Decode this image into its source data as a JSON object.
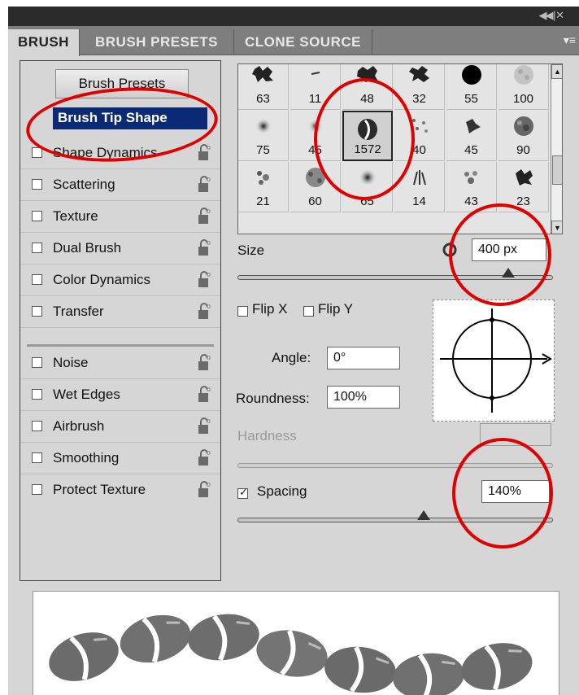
{
  "tabs": [
    {
      "label": "BRUSH",
      "active": true
    },
    {
      "label": "BRUSH PRESETS",
      "active": false
    },
    {
      "label": "CLONE SOURCE",
      "active": false
    }
  ],
  "sidebar": {
    "presets_button": "Brush Presets",
    "tip_shape": "Brush Tip Shape",
    "options": [
      {
        "label": "Shape Dynamics",
        "checked": false
      },
      {
        "label": "Scattering",
        "checked": false
      },
      {
        "label": "Texture",
        "checked": false
      },
      {
        "label": "Dual Brush",
        "checked": false
      },
      {
        "label": "Color Dynamics",
        "checked": false
      },
      {
        "label": "Transfer",
        "checked": false
      },
      {
        "label": "Noise",
        "checked": false
      },
      {
        "label": "Wet Edges",
        "checked": false
      },
      {
        "label": "Airbrush",
        "checked": false
      },
      {
        "label": "Smoothing",
        "checked": false
      },
      {
        "label": "Protect Texture",
        "checked": false
      }
    ]
  },
  "brush_grid": {
    "rows": [
      [
        "63",
        "11",
        "48",
        "32",
        "55",
        "100"
      ],
      [
        "75",
        "45",
        "1572",
        "40",
        "45",
        "90"
      ],
      [
        "21",
        "60",
        "65",
        "14",
        "43",
        "23"
      ]
    ],
    "selected": "1572"
  },
  "controls": {
    "size_label": "Size",
    "size_value": "400 px",
    "flip_x": "Flip X",
    "flip_y": "Flip Y",
    "angle_label": "Angle:",
    "angle_value": "0°",
    "roundness_label": "Roundness:",
    "roundness_value": "100%",
    "hardness_label": "Hardness",
    "hardness_value": "",
    "spacing_label": "Spacing",
    "spacing_checked": true,
    "spacing_value": "140%",
    "size_slider_fraction": 0.86,
    "spacing_slider_fraction": 0.59
  },
  "colors": {
    "highlight": "#e00000",
    "selection": "#0b2a76"
  }
}
